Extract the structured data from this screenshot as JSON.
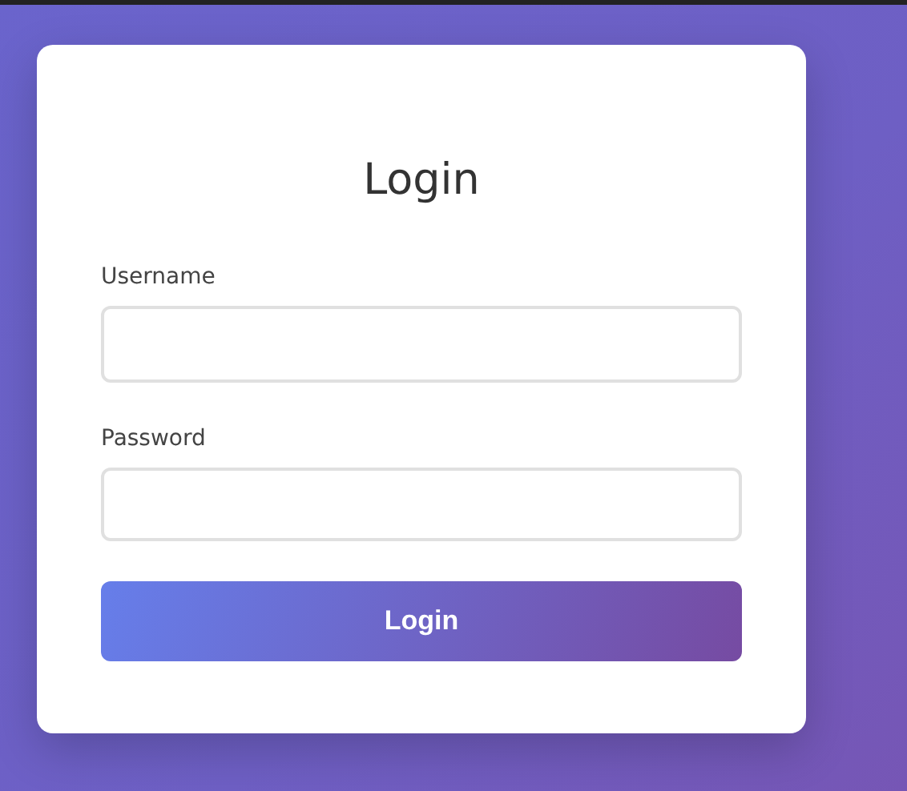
{
  "title": "Login",
  "fields": [
    {
      "label": "Username"
    },
    {
      "label": "Password"
    }
  ],
  "button": "Login"
}
